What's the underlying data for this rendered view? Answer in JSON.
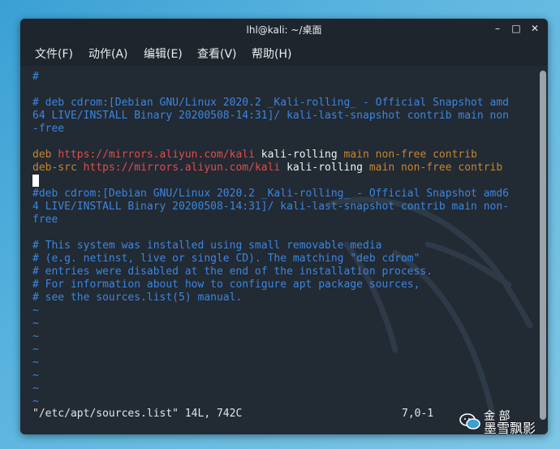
{
  "window": {
    "title": "lhl@kali: ~/桌面",
    "buttons": {
      "minimize": "–",
      "maximize": "□",
      "close": "✕"
    }
  },
  "menu": [
    "文件(F)",
    "动作(A)",
    "编辑(E)",
    "查看(V)",
    "帮助(H)"
  ],
  "editor": {
    "lines": [
      [
        {
          "t": "#",
          "c": "blue"
        }
      ],
      [],
      [
        {
          "t": "# deb cdrom:[Debian GNU/Linux 2020.2 _Kali-rolling_ - Official Snapshot amd",
          "c": "blue"
        }
      ],
      [
        {
          "t": "64 LIVE/INSTALL Binary 20200508-14:31]/ kali-last-snapshot contrib main non",
          "c": "blue"
        }
      ],
      [
        {
          "t": "-free",
          "c": "blue"
        }
      ],
      [],
      [
        {
          "t": "deb ",
          "c": "orange"
        },
        {
          "t": "https://mirrors.aliyun.com/kali",
          "c": "red"
        },
        {
          "t": " kali-rolling ",
          "c": "white"
        },
        {
          "t": "main non-free contrib",
          "c": "orange"
        }
      ],
      [
        {
          "t": "deb-src ",
          "c": "orange"
        },
        {
          "t": "https://mirrors.aliyun.com/kali",
          "c": "red"
        },
        {
          "t": " kali-rolling ",
          "c": "white"
        },
        {
          "t": "main non-free contrib",
          "c": "orange"
        }
      ],
      [
        {
          "t": "",
          "c": "cursor"
        }
      ],
      [
        {
          "t": "#deb cdrom:[Debian GNU/Linux 2020.2 _Kali-rolling_ - Official Snapshot amd6",
          "c": "blue"
        }
      ],
      [
        {
          "t": "4 LIVE/INSTALL Binary 20200508-14:31]/ kali-last-snapshot contrib main non-",
          "c": "blue"
        }
      ],
      [
        {
          "t": "free",
          "c": "blue"
        }
      ],
      [],
      [
        {
          "t": "# This system was installed using small removable media",
          "c": "blue"
        }
      ],
      [
        {
          "t": "# (e.g. netinst, live or single CD). The matching \"deb cdrom\"",
          "c": "blue"
        }
      ],
      [
        {
          "t": "# entries were disabled at the end of the installation process.",
          "c": "blue"
        }
      ],
      [
        {
          "t": "# For information about how to configure apt package sources,",
          "c": "blue"
        }
      ],
      [
        {
          "t": "# see the sources.list(5) manual.",
          "c": "blue"
        }
      ],
      [
        {
          "t": "~",
          "c": "blue"
        }
      ],
      [
        {
          "t": "~",
          "c": "blue"
        }
      ],
      [
        {
          "t": "~",
          "c": "blue"
        }
      ],
      [
        {
          "t": "~",
          "c": "blue"
        }
      ],
      [
        {
          "t": "~",
          "c": "blue"
        }
      ],
      [
        {
          "t": "~",
          "c": "blue"
        }
      ],
      [
        {
          "t": "~",
          "c": "blue"
        }
      ],
      [
        {
          "t": "~",
          "c": "blue"
        }
      ]
    ],
    "status_left": "\"/etc/apt/sources.list\" 14L, 742C",
    "status_right": "7,0-1"
  },
  "watermark": {
    "line1": "金 部",
    "line2": "墨雪飘影",
    "icon": "wechat-icon"
  }
}
